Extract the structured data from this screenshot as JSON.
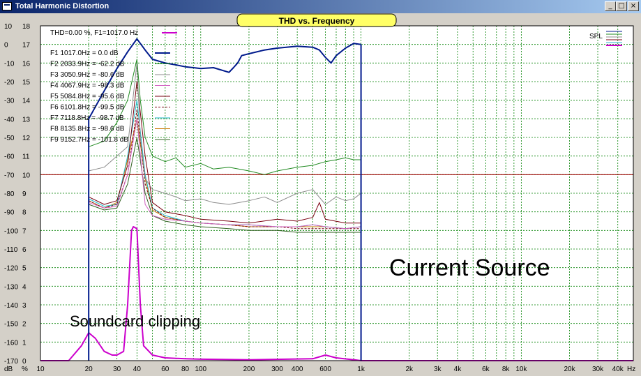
{
  "window": {
    "title": "Total Harmonic Distortion",
    "minimize_glyph": "_",
    "maximize_glyph": "□",
    "close_glyph": "×"
  },
  "chart_data": {
    "type": "line",
    "title": "THD vs. Frequency",
    "x_scale": "log",
    "xlim": [
      10,
      50000
    ],
    "x_tick_values": [
      10,
      20,
      30,
      40,
      60,
      80,
      100,
      200,
      300,
      400,
      600,
      1000,
      2000,
      3000,
      4000,
      6000,
      8000,
      10000,
      20000,
      30000,
      40000
    ],
    "x_tick_labels": [
      "10",
      "20",
      "30",
      "40",
      "60",
      "80",
      "100",
      "200",
      "300",
      "400",
      "600",
      "1k",
      "2k",
      "3k",
      "4k",
      "6k",
      "8k",
      "10k",
      "20k",
      "30k",
      "40k"
    ],
    "x_unit": "Hz",
    "ylim_db": [
      -170,
      10
    ],
    "y_db_ticks": [
      10,
      0,
      -10,
      -20,
      -30,
      -40,
      -50,
      -60,
      -70,
      -80,
      -90,
      -100,
      -110,
      -120,
      -130,
      -140,
      -150,
      -160,
      -170
    ],
    "y_db_unit": "dB",
    "ylim_pct": [
      0,
      18
    ],
    "y_pct_ticks": [
      18,
      17,
      16,
      15,
      14,
      13,
      12,
      11,
      10,
      9,
      8,
      7,
      6,
      5,
      4,
      3,
      2,
      1,
      0
    ],
    "y_pct_unit": "%",
    "reference_line_db": -70,
    "grid": true,
    "thd_summary": "THD=0.00 %, F1=1017.0 Hz",
    "legend_position": "top-left",
    "series_legend": [
      {
        "label": "F1 1017.0Hz = 0.0 dB",
        "color": "#001a8c",
        "style": "solid"
      },
      {
        "label": "F2 2033.9Hz = -62.2 dB",
        "color": "#228b22",
        "style": "solid"
      },
      {
        "label": "F3 3050.9Hz = -80.6 dB",
        "color": "#8c8c8c",
        "style": "solid"
      },
      {
        "label": "F4 4067.9Hz = -98.3 dB",
        "color": "#d060c0",
        "style": "solid"
      },
      {
        "label": "F5 5084.8Hz = -95.6 dB",
        "color": "#7a0010",
        "style": "solid"
      },
      {
        "label": "F6 6101.8Hz = -99.5 dB",
        "color": "#7a0010",
        "style": "dashed"
      },
      {
        "label": "F7 7118.8Hz = -98.7 dB",
        "color": "#1fb8c8",
        "style": "solid"
      },
      {
        "label": "F8 8135.8Hz = -98.6 dB",
        "color": "#c87800",
        "style": "solid"
      },
      {
        "label": "F9 9152.7Hz = -101.8 dB",
        "color": "#306020",
        "style": "solid"
      }
    ],
    "thd_legend_color": "#cc00cc",
    "spl_label": "SPL",
    "spl_swatches": [
      "#001a8c",
      "#228b22",
      "#8c8c8c",
      "#7a0010",
      "#1fb8c8",
      "#cc00cc"
    ],
    "annotations": [
      "Current Source",
      "Soundcard clipping"
    ],
    "series": [
      {
        "name": "F1",
        "color": "#001a8c",
        "width": 2,
        "unit": "dB",
        "x": [
          20,
          25,
          30,
          35,
          40,
          45,
          50,
          60,
          70,
          80,
          90,
          100,
          120,
          150,
          160,
          170,
          180,
          200,
          250,
          300,
          400,
          500,
          550,
          600,
          650,
          700,
          800,
          900,
          1000
        ],
        "y": [
          -40,
          -25,
          -13,
          -4,
          3,
          -3,
          -8,
          -10,
          -11,
          -12,
          -12.5,
          -13,
          -12.5,
          -15,
          -12.5,
          -10,
          -6,
          -5,
          -3,
          -2,
          -1,
          -1.5,
          -3,
          -7,
          -10,
          -6,
          -2,
          0.5,
          0
        ]
      },
      {
        "name": "F2",
        "color": "#228b22",
        "unit": "dB",
        "x": [
          20,
          25,
          30,
          35,
          40,
          42,
          45,
          50,
          60,
          70,
          80,
          100,
          120,
          150,
          200,
          250,
          300,
          400,
          500,
          600,
          700,
          800,
          900,
          1000
        ],
        "y": [
          -55,
          -52,
          -42,
          -30,
          -8,
          -30,
          -50,
          -60,
          -63,
          -61,
          -66,
          -64,
          -67,
          -66,
          -68,
          -70,
          -68,
          -66,
          -65,
          -63,
          -62,
          -61,
          -62,
          -62
        ]
      },
      {
        "name": "F3",
        "color": "#8c8c8c",
        "unit": "dB",
        "x": [
          20,
          25,
          30,
          35,
          40,
          42,
          45,
          50,
          60,
          70,
          80,
          100,
          120,
          150,
          200,
          250,
          300,
          400,
          500,
          600,
          700,
          800,
          900,
          1000
        ],
        "y": [
          -68,
          -66,
          -60,
          -55,
          -10,
          -50,
          -72,
          -78,
          -80,
          -82,
          -84,
          -83,
          -85,
          -86,
          -84,
          -82,
          -85,
          -80,
          -78,
          -86,
          -82,
          -84,
          -83,
          -80
        ]
      },
      {
        "name": "F4",
        "color": "#d060c0",
        "unit": "dB",
        "x": [
          20,
          25,
          30,
          35,
          40,
          45,
          50,
          60,
          80,
          100,
          150,
          200,
          300,
          400,
          500,
          600,
          800,
          1000
        ],
        "y": [
          -85,
          -88,
          -87,
          -70,
          -40,
          -86,
          -92,
          -94,
          -95,
          -96,
          -97,
          -97,
          -98,
          -98,
          -97,
          -98,
          -99,
          -98
        ]
      },
      {
        "name": "F5",
        "color": "#7a0010",
        "unit": "dB",
        "x": [
          20,
          25,
          30,
          35,
          40,
          45,
          50,
          60,
          80,
          100,
          150,
          200,
          300,
          400,
          500,
          550,
          600,
          800,
          1000
        ],
        "y": [
          -82,
          -86,
          -84,
          -65,
          -20,
          -60,
          -85,
          -90,
          -92,
          -94,
          -95,
          -96,
          -94,
          -95,
          -93,
          -85,
          -94,
          -96,
          -96
        ]
      },
      {
        "name": "F6",
        "color": "#7a0010",
        "dashed": true,
        "unit": "dB",
        "x": [
          20,
          25,
          30,
          35,
          40,
          45,
          50,
          60,
          80,
          100,
          150,
          200,
          300,
          400,
          600,
          800,
          1000
        ],
        "y": [
          -84,
          -88,
          -86,
          -70,
          -35,
          -75,
          -88,
          -93,
          -95,
          -96,
          -97,
          -98,
          -98,
          -99,
          -99,
          -99,
          -99
        ]
      },
      {
        "name": "F7",
        "color": "#1fb8c8",
        "unit": "dB",
        "x": [
          20,
          25,
          30,
          35,
          40,
          45,
          50,
          60,
          80,
          100,
          150,
          200,
          300,
          400,
          500,
          600,
          800,
          1000
        ],
        "y": [
          -83,
          -87,
          -86,
          -60,
          -30,
          -70,
          -88,
          -92,
          -95,
          -96,
          -97,
          -97,
          -98,
          -98,
          -97,
          -98,
          -99,
          -98
        ]
      },
      {
        "name": "F8",
        "color": "#c87800",
        "unit": "dB",
        "x": [
          20,
          25,
          30,
          35,
          40,
          45,
          50,
          60,
          80,
          100,
          150,
          200,
          300,
          400,
          600,
          800,
          1000
        ],
        "y": [
          -84,
          -88,
          -85,
          -62,
          -40,
          -72,
          -89,
          -93,
          -95,
          -96,
          -97,
          -98,
          -98,
          -98,
          -98,
          -99,
          -98
        ]
      },
      {
        "name": "F9",
        "color": "#306020",
        "unit": "dB",
        "x": [
          20,
          25,
          30,
          35,
          40,
          45,
          50,
          60,
          80,
          100,
          150,
          200,
          300,
          400,
          600,
          800,
          1000
        ],
        "y": [
          -86,
          -89,
          -88,
          -75,
          -50,
          -80,
          -92,
          -95,
          -97,
          -98,
          -99,
          -100,
          -100,
          -101,
          -101,
          -101,
          -101
        ]
      },
      {
        "name": "THD",
        "color": "#cc00cc",
        "width": 2,
        "unit": "%",
        "x": [
          10,
          15,
          18,
          20,
          22,
          25,
          28,
          30,
          33,
          35,
          37,
          38,
          40,
          42,
          44,
          50,
          60,
          80,
          100,
          200,
          500,
          600,
          700,
          900,
          1000,
          2000,
          50000
        ],
        "y": [
          0,
          0,
          0.8,
          1.5,
          1.2,
          0.5,
          0.3,
          0.3,
          0.5,
          3,
          7,
          7.2,
          7.1,
          3,
          0.8,
          0.3,
          0.15,
          0.1,
          0.08,
          0.05,
          0.1,
          0.3,
          0.15,
          0.05,
          0,
          0,
          0
        ]
      }
    ]
  }
}
